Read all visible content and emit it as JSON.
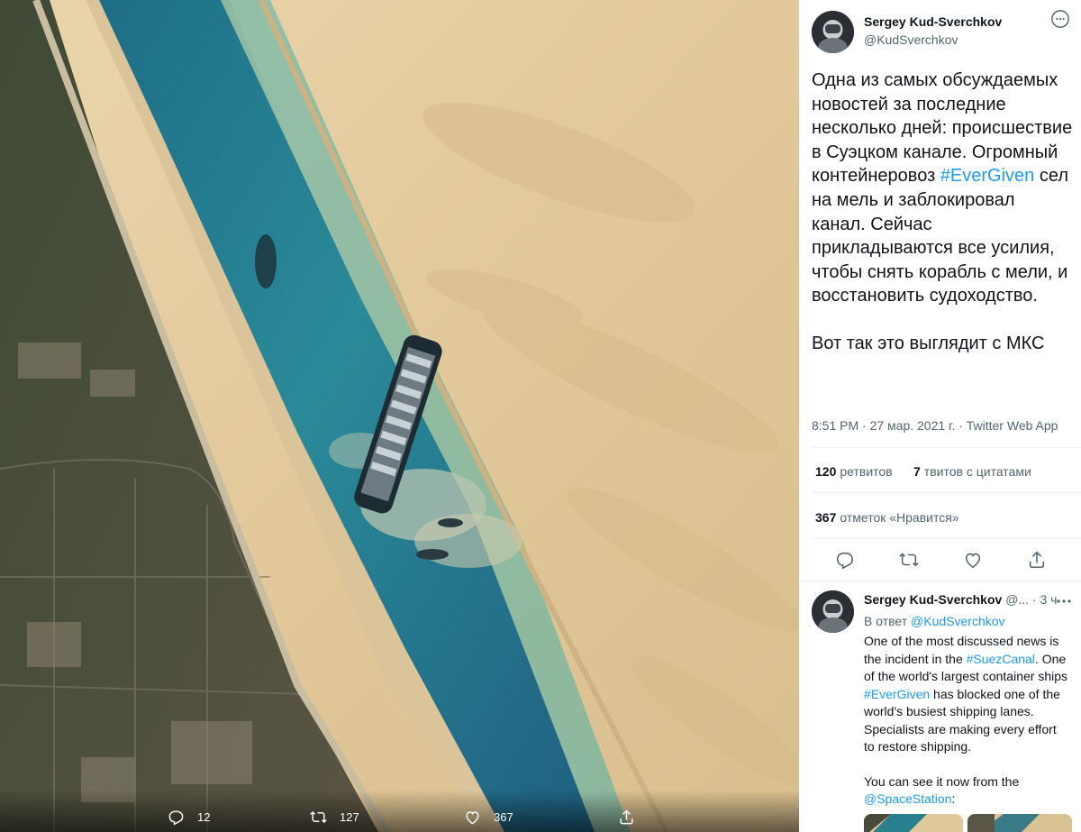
{
  "media": {
    "actions": {
      "reply_count": "12",
      "retweet_count": "127",
      "like_count": "367"
    }
  },
  "tweet": {
    "author_name": "Sergey Kud-Sverchkov",
    "author_handle": "@KudSverchkov",
    "text_part1": "Одна из самых обсуждаемых новостей за последние несколько дней: происшествие в Суэцком канале. Огромный контейнеровоз ",
    "hashtag": "#EverGiven",
    "text_part2": " сел на мель и заблокировал канал. Сейчас прикладываются все усилия, чтобы снять корабль с мели, и восстановить судоходство.",
    "text_part3": "Вот так это выглядит с МКС",
    "timestamp": "8:51 PM · 27 мар. 2021 г. · Twitter Web App",
    "retweets_count": "120",
    "retweets_label": "ретвитов",
    "quotes_count": "7",
    "quotes_label": "твитов с цитатами",
    "likes_count": "367",
    "likes_label": "отметок «Нравится»"
  },
  "reply": {
    "author_name": "Sergey Kud-Sverchkov",
    "meta": "@... · 3 ч",
    "reply_to_label": "В ответ",
    "reply_to_handle": "@KudSverchkov",
    "text_a": "One of the most discussed news is the incident in the ",
    "hashtag1": "#SuezCanal",
    "text_b": ". One of the world's largest container ships ",
    "hashtag2": "#EverGiven",
    "text_c": " has blocked one of the world's busiest shipping lanes. Specialists are making every effort to restore shipping.",
    "text_d": "You can see it now from the ",
    "mention": "@SpaceStation",
    "text_e": ":"
  },
  "colors": {
    "accent": "#1d9bf0",
    "text": "#0f1419",
    "muted": "#536471",
    "sand": "#e6cfa3",
    "water": "#1f6f86"
  },
  "icons": [
    "close-icon",
    "reply-icon",
    "retweet-icon",
    "like-icon",
    "share-icon",
    "more-icon"
  ]
}
